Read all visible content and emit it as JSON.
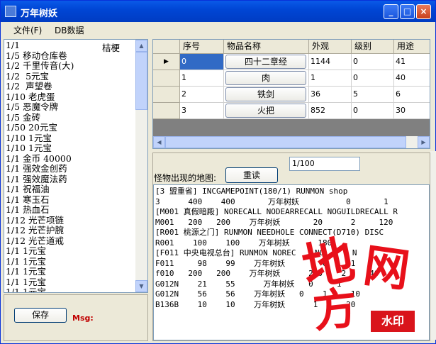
{
  "window": {
    "title": "万年树妖"
  },
  "menu": {
    "file": "文件(F)",
    "db": "DB数据"
  },
  "left_list": {
    "right_label": "桔梗",
    "items": [
      "1/1",
      "1/5 移动仓库卷",
      "1/2 千里传音(大)",
      "1/2  5元宝",
      "1/2  声望卷",
      "1/10 老虎蛋",
      "1/5 恶魔令牌",
      "1/5 金砖",
      "1/50 20元宝",
      "1/10 1元宝",
      "1/10 1元宝",
      "1/1 金币 40000",
      "1/1 强效金创药",
      "1/1 强效魔法药",
      "1/1 祝福油",
      "1/1 寒玉石",
      "1/1 热血石",
      "1/12 光芒项链",
      "1/12 光芒护腕",
      "1/12 光芒道戒",
      "1/1 1元宝",
      "1/1 1元宝",
      "1/1 1元宝",
      "1/1 1元宝",
      "1/1 1元宝",
      "1/1 1元宝",
      "1/1 1元宝"
    ]
  },
  "bottom": {
    "save_label": "保存",
    "msg_label": "Msg:"
  },
  "grid": {
    "headers": [
      "序号",
      "物品名称",
      "外观",
      "级别",
      "用途"
    ],
    "current_row_marker": "▶",
    "rows": [
      {
        "index": "0",
        "name": "四十二章经",
        "look": "1144",
        "level": "0",
        "use": "41"
      },
      {
        "index": "1",
        "name": "肉",
        "look": "1",
        "level": "0",
        "use": "40"
      },
      {
        "index": "2",
        "name": "铁剑",
        "look": "36",
        "level": "5",
        "use": "6"
      },
      {
        "index": "3",
        "name": "火把",
        "look": "852",
        "level": "0",
        "use": "30"
      }
    ]
  },
  "map_panel": {
    "label": "怪物出现的地图:",
    "reload_label": "重读",
    "page_value": "1/100",
    "lines": [
      "[3 盟重省] INCGAMEPOINT(180/1) RUNMON shop",
      "3      400    400       万年树妖          0       1",
      "[M001 真假暗殿] NORECALL NODEARRECALL NOGUILDRECALL R",
      "M001   200   200    万年树妖       20      2     120",
      "[R001 桃源之门] RUNMON NEEDHOLE CONNECT(D710) DISC",
      "R001    100    100    万年树妖      180",
      "[F011 中央电视总台] RUNMON NOREC    NO      N",
      "F011     98    99    万年树妖        0     1",
      "f010   200   200    万年树妖      200    2     40",
      "G012N    21    55      万年树妖   0     1",
      "G012N    56    56    万年树妖   0    1     10",
      "B136B    10    10    万年树妖      1      20"
    ]
  },
  "watermark": {
    "char1": "地",
    "char2": "网",
    "char3": "方",
    "stamp": "水印"
  },
  "colors": {
    "title_bar": "#0054e3",
    "selection": "#316ac5",
    "msg": "#c00000",
    "watermark": "#e8101a"
  }
}
